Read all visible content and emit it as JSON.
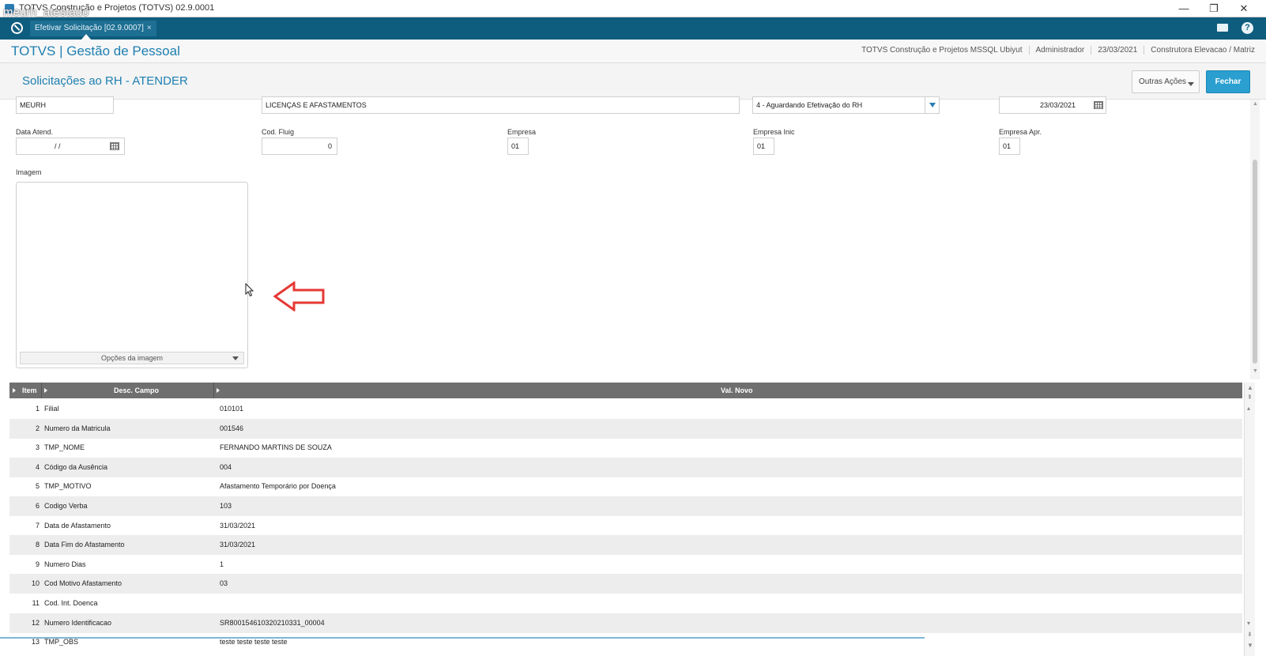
{
  "window": {
    "title": "TOTVS Construção e Projetos (TOTVS) 02.9.0001",
    "overlay_text": "meurh_atestado",
    "minimize": "—",
    "restore": "❐",
    "close": "✕"
  },
  "tabs": {
    "active_label": "Efetivar Solicitação [02.9.0007]",
    "close_glyph": "×"
  },
  "app_header": {
    "brand": "TOTVS | Gestão de Pessoal",
    "company": "TOTVS Construção e Projetos MSSQL Ubiyut",
    "user": "Administrador",
    "date": "23/03/2021",
    "branch": "Construtora Elevacao / Matriz"
  },
  "page": {
    "title": "Solicitações ao RH - ATENDER",
    "btn_outras": "Outras Ações",
    "btn_fechar": "Fechar"
  },
  "form": {
    "origin_value": "MEURH",
    "type_value": "LICENÇAS E AFASTAMENTOS",
    "status_value": "4 - Aguardando Efetivação do RH",
    "date_value": "23/03/2021",
    "data_atend_label": "Data Atend.",
    "data_atend_value": "/ /",
    "cod_fluig_label": "Cod. Fluig",
    "cod_fluig_value": "0",
    "empresa_label": "Empresa",
    "empresa_value": "01",
    "empresa_inic_label": "Empresa Inic",
    "empresa_inic_value": "01",
    "empresa_apr_label": "Empresa Apr.",
    "empresa_apr_value": "01",
    "imagem_label": "Imagem",
    "imagem_options": "Opções da imagem"
  },
  "grid": {
    "col_item": "Item",
    "col_desc": "Desc. Campo",
    "col_val": "Val. Novo",
    "rows": [
      {
        "n": "1",
        "desc": "Filial",
        "val": "010101"
      },
      {
        "n": "2",
        "desc": "Numero da Matricula",
        "val": "001546"
      },
      {
        "n": "3",
        "desc": "TMP_NOME",
        "val": "FERNANDO MARTINS DE SOUZA"
      },
      {
        "n": "4",
        "desc": "Código da Ausência",
        "val": "004"
      },
      {
        "n": "5",
        "desc": "TMP_MOTIVO",
        "val": "Afastamento Temporário por Doença"
      },
      {
        "n": "6",
        "desc": "Codigo Verba",
        "val": "103"
      },
      {
        "n": "7",
        "desc": "Data de Afastamento",
        "val": "31/03/2021"
      },
      {
        "n": "8",
        "desc": "Data Fim do Afastamento",
        "val": "31/03/2021"
      },
      {
        "n": "9",
        "desc": "Numero Dias",
        "val": "1"
      },
      {
        "n": "10",
        "desc": "Cod Motivo Afastamento",
        "val": "03"
      },
      {
        "n": "11",
        "desc": "Cod. Int. Doenca",
        "val": ""
      },
      {
        "n": "12",
        "desc": "Numero Identificacao",
        "val": "SR800154610320210331_00004"
      },
      {
        "n": "13",
        "desc": "TMP_OBS",
        "val": "teste teste teste teste"
      }
    ]
  },
  "colors": {
    "tabstrip": "#0f5d7e",
    "brand": "#1d7fb0",
    "primary_button": "#2a9fd0",
    "annotation_arrow": "#e53935"
  }
}
